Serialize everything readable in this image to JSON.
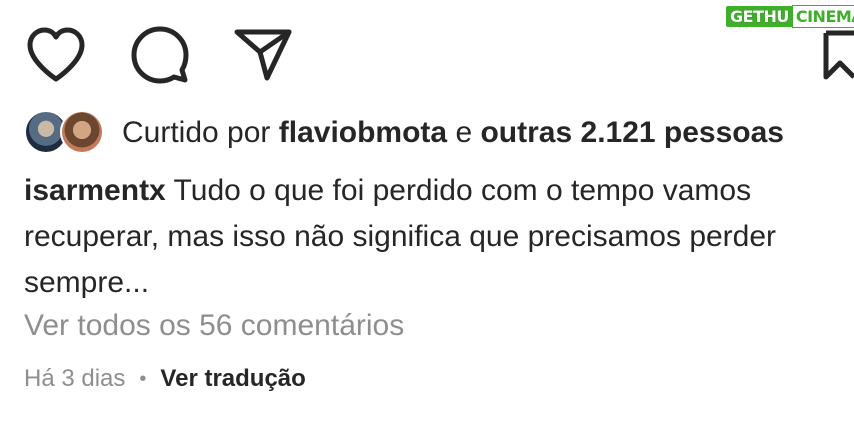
{
  "watermark": {
    "part1": "GETHU",
    "part2": "CINEMA"
  },
  "actions": {
    "like_icon": "heart-icon",
    "comment_icon": "comment-icon",
    "share_icon": "paper-plane-icon",
    "save_icon": "bookmark-icon"
  },
  "likes": {
    "prefix": "Curtido por",
    "user": "flaviobmota",
    "connector": "e",
    "others": "outras 2.121 pessoas"
  },
  "caption": {
    "username": "isarmentx",
    "text": "Tudo o que foi perdido com o tempo vamos recuperar, mas isso não significa que precisamos perder sempre..."
  },
  "comments_link": "Ver todos os 56 comentários",
  "meta": {
    "time": "Há 3 dias",
    "separator": "•",
    "translate": "Ver tradução"
  },
  "colors": {
    "text_primary": "#262626",
    "text_secondary": "#8e8e8e",
    "watermark_green": "#3fae2a"
  }
}
